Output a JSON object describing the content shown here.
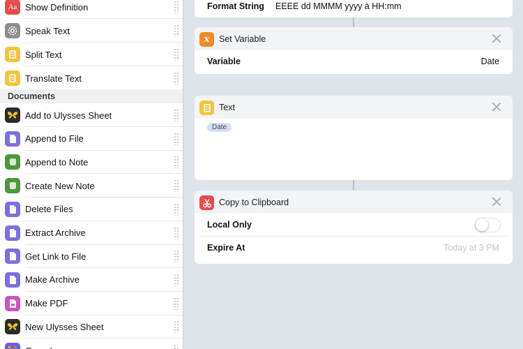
{
  "sidebar": {
    "items_top": [
      {
        "label": "Show Definition",
        "icon": "dictionary-icon",
        "color": "#e94b4b"
      },
      {
        "label": "Speak Text",
        "icon": "gear-icon",
        "color": "#8e8e93"
      },
      {
        "label": "Split Text",
        "icon": "text-icon",
        "color": "#f5c33b"
      },
      {
        "label": "Translate Text",
        "icon": "text-icon",
        "color": "#f5c33b"
      }
    ],
    "section_title": "Documents",
    "items_documents": [
      {
        "label": "Add to Ulysses Sheet",
        "icon": "ulysses-icon",
        "color": "#2b2b2b"
      },
      {
        "label": "Append to File",
        "icon": "file-icon",
        "color": "#7b6ee6"
      },
      {
        "label": "Append to Note",
        "icon": "evernote-icon",
        "color": "#4a9a3a"
      },
      {
        "label": "Create New Note",
        "icon": "evernote-icon",
        "color": "#4a9a3a"
      },
      {
        "label": "Delete Files",
        "icon": "file-icon",
        "color": "#7b6ee6"
      },
      {
        "label": "Extract Archive",
        "icon": "file-icon",
        "color": "#7b6ee6"
      },
      {
        "label": "Get Link to File",
        "icon": "file-icon",
        "color": "#7b6ee6"
      },
      {
        "label": "Make Archive",
        "icon": "file-icon",
        "color": "#7b6ee6"
      },
      {
        "label": "Make PDF",
        "icon": "pdf-icon",
        "color": "#d24fc5"
      },
      {
        "label": "New Ulysses Sheet",
        "icon": "ulysses-icon",
        "color": "#2b2b2b"
      },
      {
        "label": "Open In...",
        "icon": "apps-icon",
        "color": "#6f5de0"
      }
    ]
  },
  "workflow": {
    "format_card": {
      "field_label": "Format String",
      "field_value": "EEEE dd MMMM yyyy à HH:mm"
    },
    "set_variable_card": {
      "title": "Set Variable",
      "icon": "variable-icon",
      "color": "#f08a24",
      "field_label": "Variable",
      "field_value": "Date"
    },
    "text_card": {
      "title": "Text",
      "icon": "text-icon",
      "color": "#f5c33b",
      "token": "Date"
    },
    "clipboard_card": {
      "title": "Copy to Clipboard",
      "icon": "scissors-icon",
      "color": "#e94b4b",
      "local_only_label": "Local Only",
      "local_only_on": false,
      "expire_label": "Expire At",
      "expire_placeholder": "Today at 3 PM"
    }
  }
}
